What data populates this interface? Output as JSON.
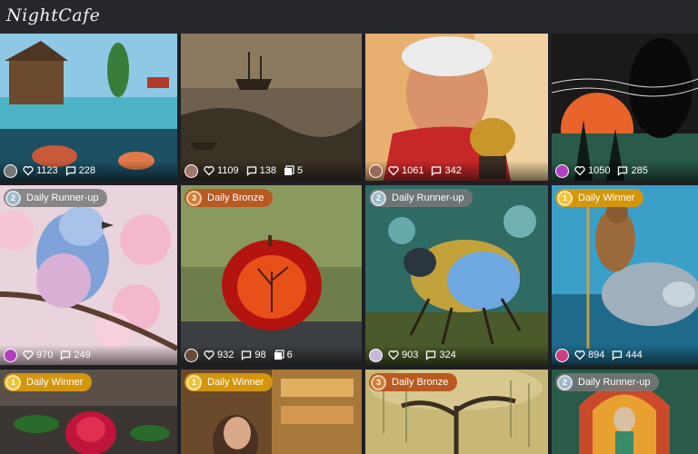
{
  "app": {
    "logo": "NightCafe"
  },
  "cards": [
    {
      "likes": "1123",
      "comments": "228"
    },
    {
      "likes": "1109",
      "comments": "138",
      "images": "5"
    },
    {
      "likes": "1061",
      "comments": "342"
    },
    {
      "likes": "1050",
      "comments": "285"
    },
    {
      "badge": "Daily Runner-up",
      "likes": "970",
      "comments": "249"
    },
    {
      "badge": "Daily Bronze",
      "likes": "932",
      "comments": "98",
      "images": "6"
    },
    {
      "badge": "Daily Runner-up",
      "likes": "903",
      "comments": "324"
    },
    {
      "badge": "Daily Winner",
      "likes": "894",
      "comments": "444"
    },
    {
      "badge": "Daily Winner"
    },
    {
      "badge": "Daily Winner"
    },
    {
      "badge": "Daily Bronze"
    },
    {
      "badge": "Daily Runner-up"
    }
  ],
  "icons": {
    "likes": "heart-icon",
    "comments": "comment-icon",
    "images": "images-icon"
  },
  "colors": {
    "topbar": "#25272c",
    "runner_up": "#787878",
    "bronze": "#b85a22",
    "winner": "#d4960d"
  }
}
